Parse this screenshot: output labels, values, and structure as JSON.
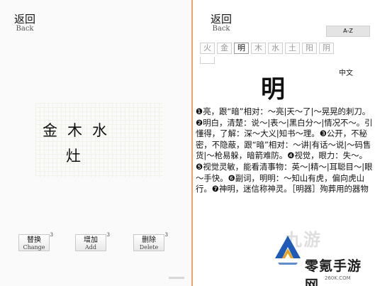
{
  "left_panel": {
    "back": {
      "zh": "返回",
      "en": "Back"
    },
    "elements_row1": [
      "金",
      "木",
      "水"
    ],
    "elements_row2": "灶",
    "buttons": [
      {
        "zh": "替换",
        "en": "Change",
        "sup": "3"
      },
      {
        "zh": "增加",
        "en": "Add",
        "sup": "3"
      },
      {
        "zh": "删除",
        "en": "Delete",
        "sup": "3"
      }
    ]
  },
  "right_panel": {
    "back": {
      "zh": "返回",
      "en": "Back"
    },
    "sort_button": "A-Z",
    "tabs": [
      "火",
      "金",
      "明",
      "木",
      "水",
      "土",
      "阳",
      "阴"
    ],
    "active_tab": "明",
    "language_label": "中文",
    "headword": "明",
    "definition": "❶亮，跟“暗”相对：～亮|天～了|～晃晃的刺刀。❷明白，清楚：说～|表～|黑白分～|情况不～。引懂得，了解：深～大义|知书～理。❸公开，不秘密，不隐蔽，跟“暗”相对：～讲|有话～说|～码售货|～枪易躲，暗箭难防。❹视觉，眼力：失～。❺视觉灵敏，能看清事物：英～|精～|耳聪目～|眼～手快。❻副词，明明：～知山有虎，偏向虎山行。❼神明，迷信称神灵。［明器］殉葬用的器物"
  },
  "watermark": {
    "text": "零氪手游网",
    "url": "260K.COM",
    "faint": "九游"
  }
}
